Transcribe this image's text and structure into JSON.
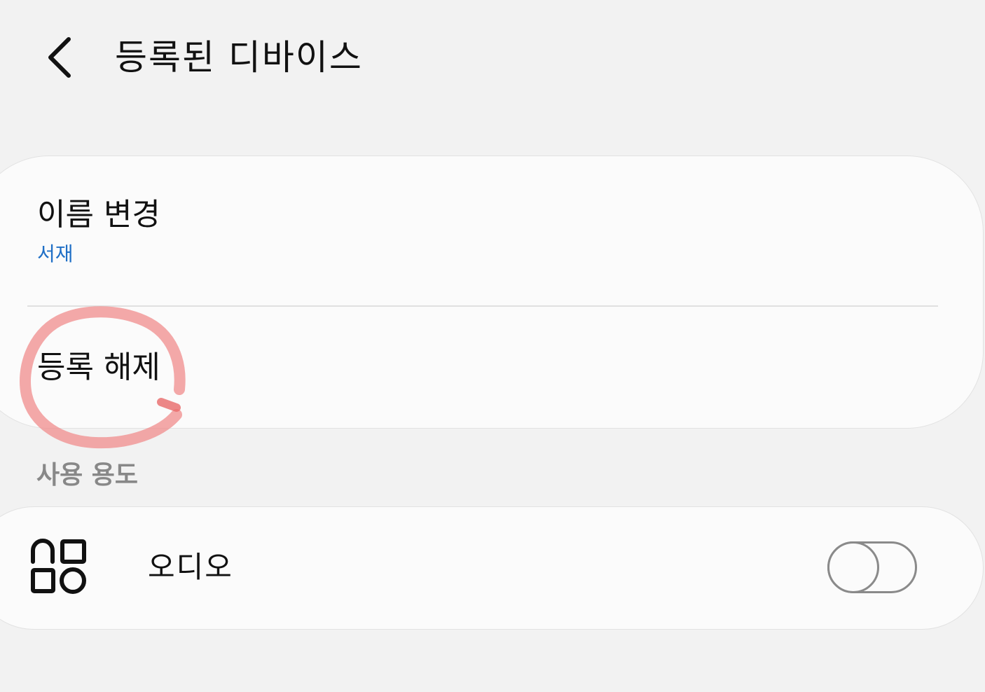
{
  "header": {
    "back_icon": "chevron-left-icon",
    "title": "등록된 디바이스"
  },
  "settings_card": {
    "rename": {
      "label": "이름 변경",
      "value": "서재",
      "value_color": "#1f6fc6"
    },
    "unregister": {
      "label": "등록 해제",
      "annotation": "red hand-drawn circle"
    }
  },
  "usage_section": {
    "label": "사용 용도",
    "items": [
      {
        "icon": "apps-grid-icon",
        "label": "오디오",
        "toggle_on": false
      }
    ]
  },
  "colors": {
    "background": "#f2f2f2",
    "card": "#fbfbfb",
    "accent_blue": "#1f6fc6",
    "annotation_red": "#f08c8c",
    "toggle_gray": "#8a8a8a"
  }
}
